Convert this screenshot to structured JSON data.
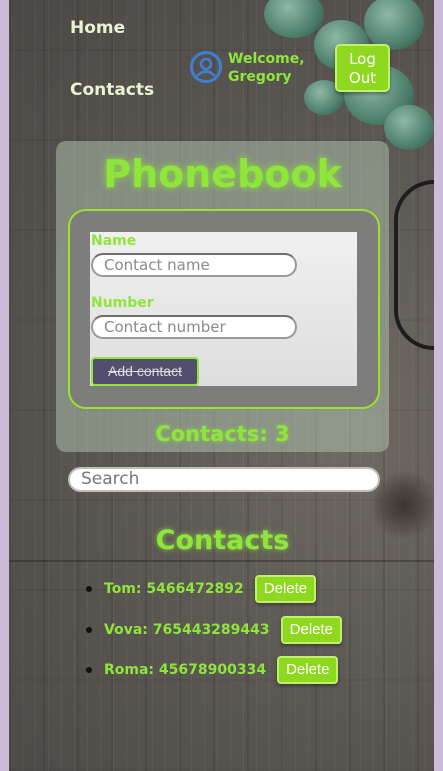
{
  "nav": {
    "home": "Home",
    "contacts": "Contacts"
  },
  "user": {
    "welcome": "Welcome,",
    "name": "Gregory",
    "logout_line1": "Log",
    "logout_line2": "Out"
  },
  "phonebook": {
    "title": "Phonebook",
    "name_label": "Name",
    "name_placeholder": "Contact name",
    "number_label": "Number",
    "number_placeholder": "Contact number",
    "add_button": "Add contact",
    "count": "Contacts: 3"
  },
  "search": {
    "placeholder": "Search"
  },
  "contacts": {
    "title": "Contacts",
    "delete_label": "Delete",
    "items": [
      {
        "text": "Tom: 5466472892"
      },
      {
        "text": "Vova: 765443289443"
      },
      {
        "text": "Roma: 45678900334"
      }
    ]
  },
  "colors": {
    "accent": "#8fe63b",
    "button": "#8ed81f",
    "add_button_bg": "#544e6e",
    "avatar": "#3e7fd6"
  },
  "icons": {
    "avatar": "user-circle-icon"
  }
}
